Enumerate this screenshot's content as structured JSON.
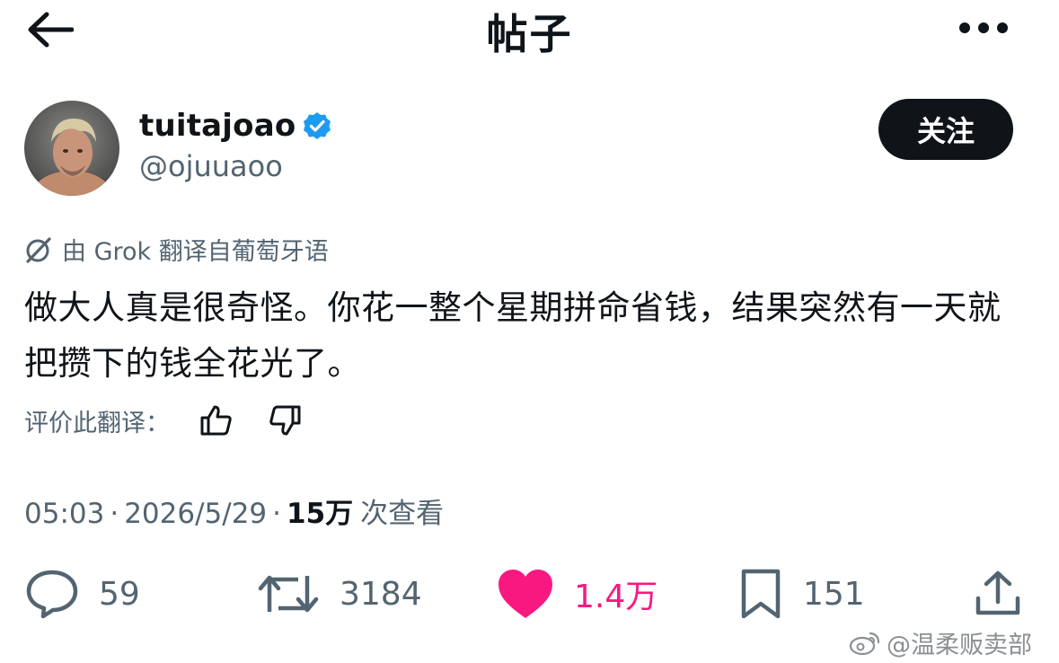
{
  "header": {
    "title": "帖子",
    "back_icon": "arrow-left-icon",
    "more_icon": "more-horizontal-icon"
  },
  "author": {
    "display_name": "tuitajoao",
    "handle": "@ojuuaoo",
    "verified": true,
    "follow_label": "关注"
  },
  "translation": {
    "label": "由 Grok 翻译自葡萄牙语",
    "rate_label": "评价此翻译："
  },
  "tweet": {
    "text": "做大人真是很奇怪。你花一整个星期拼命省钱，结果突然有一天就把攒下的钱全花光了。"
  },
  "meta": {
    "time": "05:03",
    "date": "2026/5/29",
    "separator": "·",
    "views": "15万",
    "views_label": "次查看"
  },
  "actions": {
    "replies": "59",
    "retweets": "3184",
    "likes": "1.4万",
    "bookmarks": "151"
  },
  "watermark": {
    "text": "@温柔贩卖部"
  },
  "colors": {
    "text_primary": "#0f1419",
    "text_secondary": "#536471",
    "like_pink": "#f91880",
    "verified_blue": "#1d9bf0",
    "follow_bg": "#0f1419"
  }
}
